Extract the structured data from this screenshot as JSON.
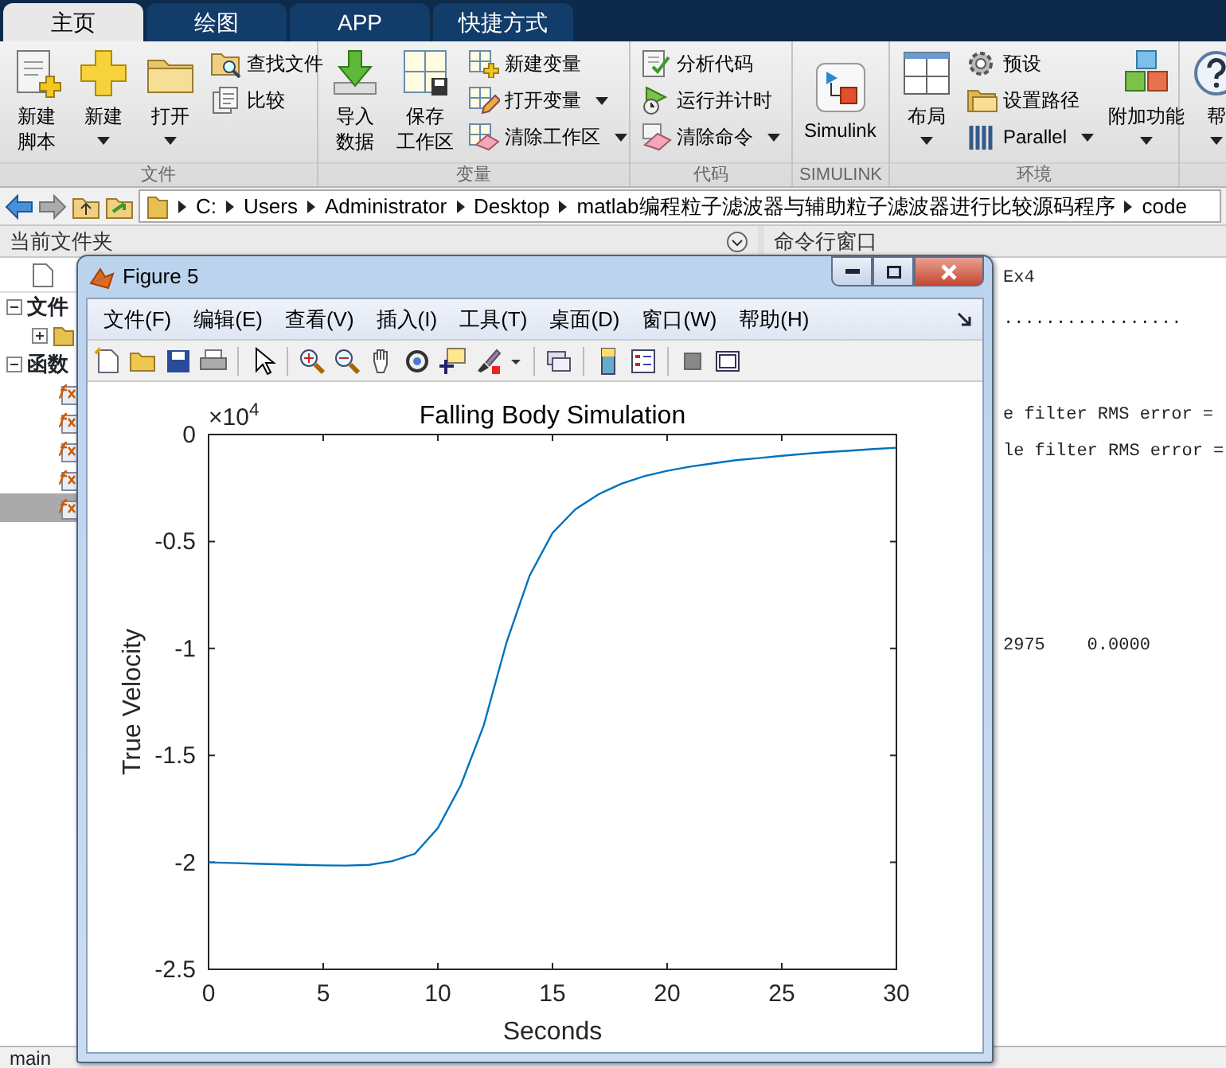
{
  "ribbon_tabs": [
    {
      "label": "主页",
      "selected": true
    },
    {
      "label": "绘图",
      "selected": false
    },
    {
      "label": "APP",
      "selected": false
    },
    {
      "label": "快捷方式",
      "selected": false
    }
  ],
  "ribbon_sections": [
    {
      "title": "文件",
      "items": [
        {
          "kind": "large",
          "label_lines": [
            "新建",
            "脚本"
          ],
          "dropdown": false
        },
        {
          "kind": "large",
          "label": "新建",
          "dropdown": true
        },
        {
          "kind": "large",
          "label": "打开",
          "dropdown": true
        },
        {
          "kind": "small",
          "label": "查找文件",
          "dropdown": false
        },
        {
          "kind": "small",
          "label": "比较",
          "dropdown": false
        }
      ]
    },
    {
      "title": "变量",
      "items": [
        {
          "kind": "large",
          "label_lines": [
            "导入",
            "数据"
          ],
          "dropdown": false
        },
        {
          "kind": "large",
          "label_lines": [
            "保存",
            "工作区"
          ],
          "dropdown": false
        },
        {
          "kind": "small",
          "label": "新建变量",
          "dropdown": false
        },
        {
          "kind": "small",
          "label": "打开变量",
          "dropdown": true
        },
        {
          "kind": "small",
          "label": "清除工作区",
          "dropdown": true
        }
      ]
    },
    {
      "title": "代码",
      "items": [
        {
          "kind": "small",
          "label": "分析代码",
          "dropdown": false
        },
        {
          "kind": "small",
          "label": "运行并计时",
          "dropdown": false
        },
        {
          "kind": "small",
          "label": "清除命令",
          "dropdown": true
        }
      ]
    },
    {
      "title": "SIMULINK",
      "items": [
        {
          "kind": "large",
          "label": "Simulink",
          "dropdown": false
        }
      ]
    },
    {
      "title": "环境",
      "items": [
        {
          "kind": "large",
          "label": "布局",
          "dropdown": true
        },
        {
          "kind": "small",
          "label": "预设",
          "dropdown": false
        },
        {
          "kind": "small",
          "label": "设置路径",
          "dropdown": false
        },
        {
          "kind": "small",
          "label": "Parallel",
          "dropdown": true
        },
        {
          "kind": "large",
          "label": "附加功能",
          "dropdown": true
        }
      ]
    },
    {
      "items": [
        {
          "kind": "large",
          "label": "帮",
          "dropdown": true
        }
      ]
    }
  ],
  "path": [
    "C:",
    "Users",
    "Administrator",
    "Desktop",
    "matlab编程粒子滤波器与辅助粒子滤波器进行比较源码程序",
    "code"
  ],
  "current_folder": {
    "title": "当前文件夹",
    "tree": [
      {
        "kind": "group",
        "label": "文件",
        "expanded": true,
        "children": [
          {
            "kind": "folder",
            "expanded": false
          }
        ]
      },
      {
        "kind": "group",
        "label": "函数",
        "expanded": true,
        "children": [
          {
            "kind": "function",
            "selected": false
          },
          {
            "kind": "function",
            "selected": false
          },
          {
            "kind": "function",
            "selected": false
          },
          {
            "kind": "function",
            "selected": false
          },
          {
            "kind": "function",
            "selected": true
          }
        ]
      }
    ]
  },
  "command_window": {
    "title": "命令行窗口",
    "lines": [
      "Ex4",
      ".................",
      "e filter RMS error =",
      "le filter RMS error =",
      "2975    0.0000"
    ]
  },
  "status_bar": "main",
  "figure": {
    "title": "Figure 5",
    "menu": [
      "文件(F)",
      "编辑(E)",
      "查看(V)",
      "插入(I)",
      "工具(T)",
      "桌面(D)",
      "窗口(W)",
      "帮助(H)"
    ],
    "chart_data": {
      "type": "line",
      "title": "Falling Body Simulation",
      "xlabel": "Seconds",
      "ylabel": "True Velocity",
      "x": [
        0,
        1,
        2,
        3,
        4,
        5,
        6,
        7,
        8,
        9,
        10,
        11,
        12,
        13,
        14,
        15,
        16,
        17,
        18,
        19,
        20,
        21,
        22,
        23,
        24,
        25,
        26,
        27,
        28,
        29,
        30
      ],
      "series": [
        {
          "color": "#0072bd",
          "values": [
            -2.0,
            -2.003,
            -2.006,
            -2.009,
            -2.012,
            -2.014,
            -2.015,
            -2.012,
            -1.995,
            -1.96,
            -1.84,
            -1.64,
            -1.36,
            -0.97,
            -0.66,
            -0.46,
            -0.35,
            -0.28,
            -0.23,
            -0.195,
            -0.17,
            -0.15,
            -0.135,
            -0.12,
            -0.11,
            -0.1,
            -0.09,
            -0.082,
            -0.075,
            -0.068,
            -0.062
          ]
        }
      ],
      "xlim": [
        0,
        30
      ],
      "ylim": [
        -2.5,
        0
      ],
      "xticks": [
        0,
        5,
        10,
        15,
        20,
        25,
        30
      ],
      "yticks": [
        -2.5,
        -2,
        -1.5,
        -1,
        -0.5,
        0
      ],
      "annotations": [
        "×10$^{4}$"
      ]
    }
  }
}
